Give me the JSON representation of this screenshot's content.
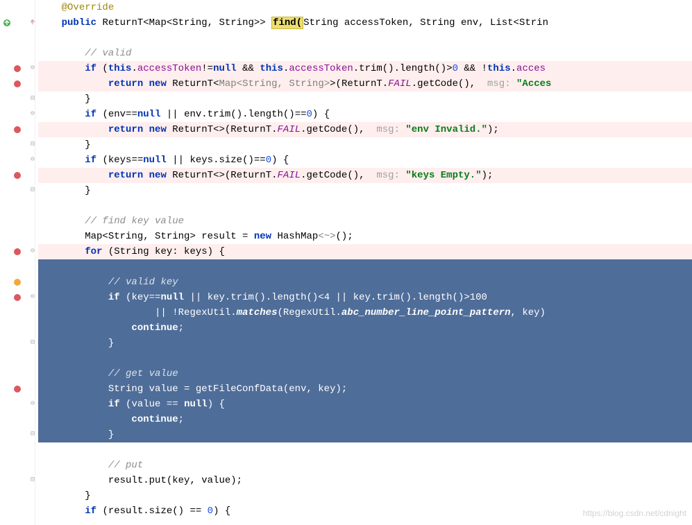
{
  "code": {
    "l1_anno": "@Override",
    "l2_kw_public": "public",
    "l2_type": "ReturnT<Map<String, String>>",
    "l2_fn": "find(",
    "l2_params": "String accessToken, String env, List<Strin",
    "l4_comment": "// valid",
    "l5_if": "if",
    "l5_this1": "this",
    "l5_field1": "accessToken",
    "l5_null": "null",
    "l5_and": "&&",
    "l5_this2": "this",
    "l5_field2": "accessToken",
    "l5_trim": ".trim().length()>",
    "l5_zero": "0",
    "l5_and2": "&&",
    "l5_neg": "!",
    "l5_this3": "this",
    "l5_field3": "acces",
    "l6_return": "return",
    "l6_new": "new",
    "l6_type": "ReturnT<",
    "l6_hint_type": "Map<String, String>",
    "l6_rest": ">(ReturnT.",
    "l6_fail": "FAIL",
    "l6_getcode": ".getCode(),",
    "l6_msghint": "msg:",
    "l6_str": "\"Acces",
    "l8_if": "if",
    "l8_cond": "(env==",
    "l8_null": "null",
    "l8_or": "|| env.trim().length()==",
    "l8_zero": "0",
    "l8_close": ") {",
    "l9_return": "return",
    "l9_new": "new",
    "l9_type": "ReturnT<>(ReturnT.",
    "l9_fail": "FAIL",
    "l9_getcode": ".getCode(),",
    "l9_msghint": "msg:",
    "l9_str": "\"env Invalid.\"",
    "l9_close": ");",
    "l11_if": "if",
    "l11_cond": "(keys==",
    "l11_null": "null",
    "l11_or": "|| keys.size()==",
    "l11_zero": "0",
    "l11_close": ") {",
    "l12_return": "return",
    "l12_new": "new",
    "l12_type": "ReturnT<>(ReturnT.",
    "l12_fail": "FAIL",
    "l12_getcode": ".getCode(),",
    "l12_msghint": "msg:",
    "l12_str": "\"keys Empty.\"",
    "l12_close": ");",
    "l15_comment": "// find key value",
    "l16_decl": "Map<String, String> result =",
    "l16_new": "new",
    "l16_type": "HashMap",
    "l16_diamond": "<~>",
    "l16_close": "();",
    "l17_for": "for",
    "l17_decl": "(String key: keys) {",
    "l19_comment": "// valid key",
    "l20_if": "if",
    "l20_a": "(key==",
    "l20_null": "null",
    "l20_b": "|| key.trim().length()<4 || key.trim().length()>100",
    "l21_a": "|| !RegexUtil.",
    "l21_fn": "matches",
    "l21_b": "(RegexUtil.",
    "l21_const": "abc_number_line_point_pattern",
    "l21_c": ", key)",
    "l22_cont": "continue",
    "l25_comment": "// get value",
    "l26_decl": "String value = getFileConfData(env, key);",
    "l27_if": "if",
    "l27_a": "(value ==",
    "l27_null": "null",
    "l27_b": ") {",
    "l28_cont": "continue",
    "l31_comment": "// put",
    "l32_put": "result.put(key, value);",
    "l34_if": "if",
    "l34_cond": "(result.size() ==",
    "l34_zero": "0",
    "l34_close": ") {"
  },
  "watermark": "https://blog.csdn.net/cdnight",
  "gutter": {
    "override_icon": "override-marker",
    "breakpoints": [
      {
        "line": 5,
        "type": "bp"
      },
      {
        "line": 6,
        "type": "bp"
      },
      {
        "line": 9,
        "type": "bp"
      },
      {
        "line": 12,
        "type": "bp"
      },
      {
        "line": 17,
        "type": "bp"
      },
      {
        "line": 19,
        "type": "bp-warn"
      },
      {
        "line": 20,
        "type": "bp"
      },
      {
        "line": 26,
        "type": "bp"
      }
    ]
  }
}
